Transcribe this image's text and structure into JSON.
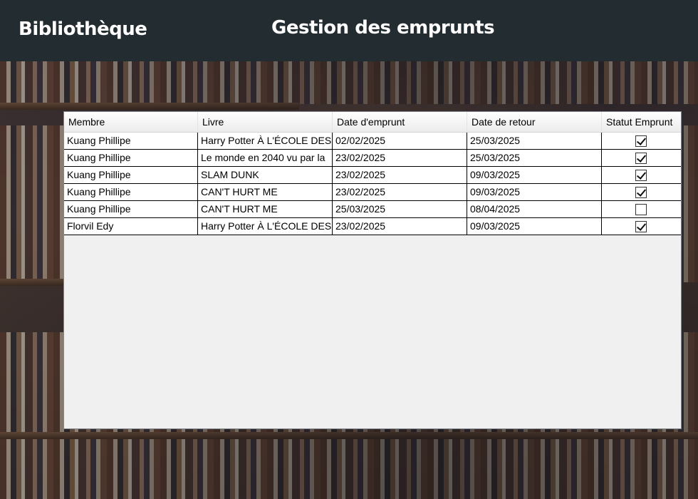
{
  "header": {
    "brand": "Bibliothèque",
    "title": "Gestion des emprunts"
  },
  "grid": {
    "columns": [
      "Membre",
      "Livre",
      "Date d'emprunt",
      "Date de retour",
      "Statut Emprunt"
    ],
    "rows": [
      {
        "membre": "Kuang Phillipe",
        "livre": "Harry Potter À L'ÉCOLE DES",
        "date_emprunt": "02/02/2025",
        "date_retour": "25/03/2025",
        "statut": true
      },
      {
        "membre": "Kuang Phillipe",
        "livre": "Le monde en 2040 vu par la",
        "date_emprunt": "23/02/2025",
        "date_retour": "25/03/2025",
        "statut": true
      },
      {
        "membre": "Kuang Phillipe",
        "livre": "SLAM DUNK",
        "date_emprunt": "23/02/2025",
        "date_retour": "09/03/2025",
        "statut": true
      },
      {
        "membre": "Kuang Phillipe",
        "livre": "CAN'T HURT ME",
        "date_emprunt": "23/02/2025",
        "date_retour": "09/03/2025",
        "statut": true
      },
      {
        "membre": "Kuang Phillipe",
        "livre": "CAN'T HURT ME",
        "date_emprunt": "25/03/2025",
        "date_retour": "08/04/2025",
        "statut": false
      },
      {
        "membre": "Florvil Edy",
        "livre": "Harry Potter À L'ÉCOLE DES",
        "date_emprunt": "23/02/2025",
        "date_retour": "09/03/2025",
        "statut": true
      }
    ]
  },
  "colors": {
    "header_bg": "#232c31",
    "grid_bg": "#f0f0f0",
    "row_bg": "#ffffff"
  }
}
